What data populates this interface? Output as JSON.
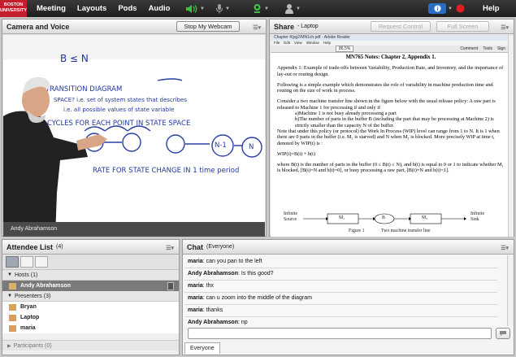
{
  "topbar": {
    "logo_line1": "BOSTON",
    "logo_line2": "UNIVERSITY",
    "menu": [
      "Meeting",
      "Layouts",
      "Pods",
      "Audio"
    ],
    "help": "Help",
    "colors": {
      "bar": "#262626",
      "logo": "#c41e2c",
      "audio_icon": "#3fbf3f",
      "record": "#e02020",
      "status": "#2a6ec4"
    }
  },
  "camera_pod": {
    "title": "Camera and Voice",
    "stop_webcam": "Stop My Webcam",
    "speaker": "Andy Abrahamson",
    "whiteboard_lines": [
      "B ≤ N",
      "TRANSITION DIAGRAM",
      "SPACE? i.e. set of system states that describes",
      "i.e. all possible values of state variable",
      "CYCLES FOR EACH POINT IN STATE SPACE",
      "N-1",
      "N",
      "RATE FOR STATE CHANGE IN 1 time period"
    ]
  },
  "share_pod": {
    "title": "Share",
    "subtitle": "- Laptop",
    "request_control": "Request Control",
    "full_screen": "Full Screen",
    "viewer_title": "Chapter 4(pg2/MN1ch.pdf - Adobe Reader",
    "viewer_menu": [
      "File",
      "Edit",
      "View",
      "Window",
      "Help"
    ],
    "zoom": "86.5%",
    "tools_links": [
      "Comment",
      "Tools",
      "Sign"
    ],
    "doc": {
      "heading": "MN765 Notes: Chapter 2, Appendix 1.",
      "p1": "Appendix 1: Example of trade-offs between Variability, Production Rate, and Inventory, and the importance of lay-out or routing design.",
      "p2": "Following is a simple example which demonstrates the role of variability in machine production time and routing on the size of work in process.",
      "p3": "Consider a two machine transfer line shown in the figure below with the usual release policy: A raw part is released to Machine 1 for processing if and only if",
      "p3a": "a)Machine 1 is not busy already processing a part",
      "p3b": "b)The number of parts in the buffer B (including the part that may be processing at Machine 2) is strictly smaller than the capacity N of the buffer.",
      "p4": "Note that under this policy (or protocol) the Work In Process (WIP) level can range from 1 to N. It is 1 when there are 0 parts in the buffer (i.e. M₁ is starved) and N when M₁ is blocked. More precisely WIP at time t, denoted by WIP(t) is :",
      "eq": "WIP(t)=B(t) + b(t)",
      "p5": "where B(t) is the number of parts in the buffer (0 ≤ B(t) ≤ N), and b(t) is equal to 0 or 1 to indicate whether M₁ is blocked, [B(t)=N and b(t)=0], or busy processing a raw part, [B(t)=N and b(t)=1].",
      "source": "Infinite\nSource",
      "sink": "Infinite\nSink",
      "m1": "M₁",
      "buf": "B",
      "m2": "M₂",
      "fig": "Figure 1",
      "fig_caption": "Two machine transfer line"
    }
  },
  "attendees": {
    "title": "Attendee List",
    "count": "(4)",
    "hosts_label": "Hosts (1)",
    "host": "Andy Abrahamson",
    "presenters_label": "Presenters (3)",
    "presenters": [
      "Bryan",
      "Laptop",
      "maria"
    ],
    "participants_label": "Participants (0)"
  },
  "chat": {
    "title": "Chat",
    "subtitle": "(Everyone)",
    "messages": [
      {
        "user": "maria",
        "text": "can you pan to the left"
      },
      {
        "user": "Andy Abrahamson",
        "text": "Is this good?"
      },
      {
        "user": "maria",
        "text": "thx"
      },
      {
        "user": "maria",
        "text": "can u zoom into the middle of the diagram"
      },
      {
        "user": "maria",
        "text": "thanks"
      },
      {
        "user": "Andy Abrahamson",
        "text": "np"
      }
    ],
    "input_value": "",
    "tab": "Everyone"
  }
}
